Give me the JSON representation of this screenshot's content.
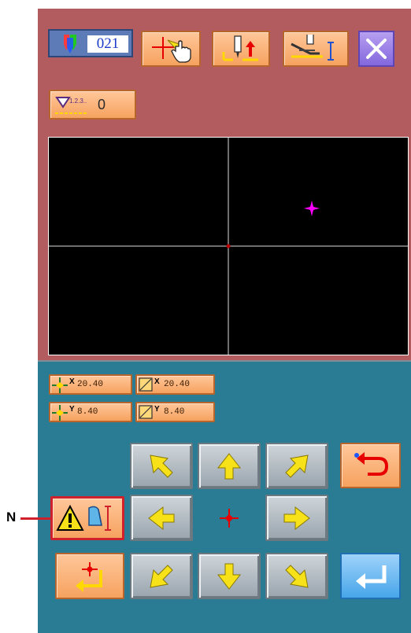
{
  "header": {
    "counter_value": "021",
    "stitch_value": "0"
  },
  "moves": {
    "x_move": "20.40",
    "y_move": "8.40",
    "x_size": "20.40",
    "y_size": "8.40"
  },
  "callout": {
    "label": "N",
    "color": "#d0202b"
  },
  "colors": {
    "top_panel": "#b35c60",
    "bottom_panel": "#2a7c94",
    "button_orange": "#f6a25f",
    "button_gray": "#aab3bb",
    "arrow_yellow": "#f7e21a",
    "cursor_magenta": "#ff00ff",
    "close_purple": "#8367de",
    "enter_blue": "#47a6e9"
  }
}
